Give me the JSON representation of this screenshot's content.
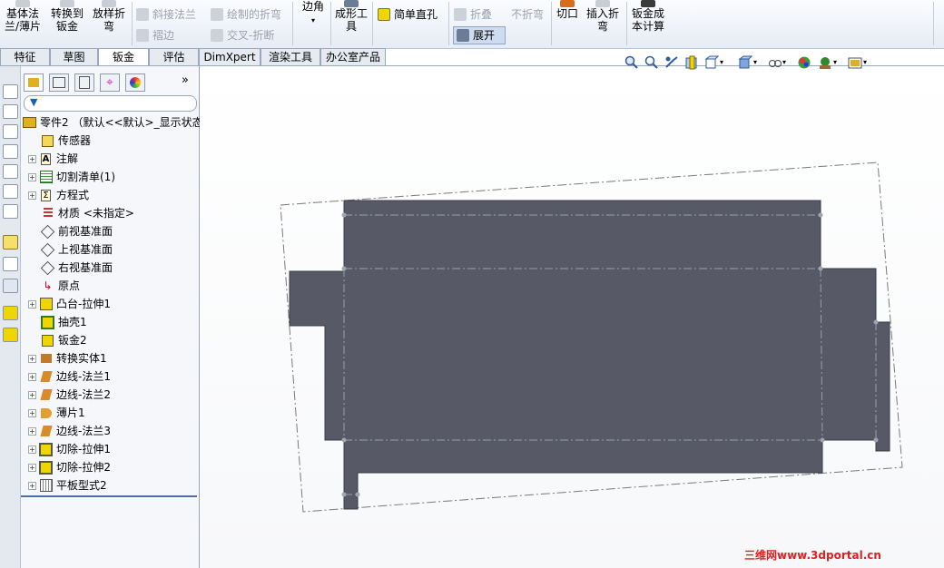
{
  "ribbon": {
    "buttons": [
      {
        "label_line1": "基体法",
        "label_line2": "兰/薄片",
        "enabled": true
      },
      {
        "label_line1": "转换到",
        "label_line2": "钣金",
        "enabled": true
      },
      {
        "label_line1": "放样折",
        "label_line2": "弯",
        "enabled": true
      },
      {
        "label": "斜接法兰",
        "enabled": false
      },
      {
        "label": "褶边",
        "enabled": false
      },
      {
        "label": "绘制的折弯",
        "enabled": false
      },
      {
        "label": "交叉-折断",
        "enabled": false
      },
      {
        "label": "边角",
        "enabled": true
      },
      {
        "label_line1": "成形工",
        "label_line2": "具",
        "enabled": true
      },
      {
        "label": "简单直孔",
        "enabled": true
      },
      {
        "label": "折叠",
        "enabled": false
      },
      {
        "label": "不折弯",
        "enabled": false
      },
      {
        "label": "展开",
        "enabled": true,
        "active": true
      },
      {
        "label": "切口",
        "enabled": true
      },
      {
        "label_line1": "插入折",
        "label_line2": "弯",
        "enabled": true
      },
      {
        "label_line1": "钣金成",
        "label_line2": "本计算",
        "enabled": true
      }
    ]
  },
  "tabs": [
    "特征",
    "草图",
    "钣金",
    "评估",
    "DimXpert",
    "渲染工具",
    "办公室产品"
  ],
  "active_tab": "钣金",
  "panel": {
    "expand_glyph": "»",
    "tree": [
      {
        "label": "零件2 （默认<<默认>_显示状态",
        "expander": false
      },
      {
        "label": "传感器",
        "expander": false
      },
      {
        "label": "注解",
        "expander": true
      },
      {
        "label": "切割清单(1)",
        "expander": true
      },
      {
        "label": "方程式",
        "expander": true
      },
      {
        "label": "材质 <未指定>",
        "expander": false
      },
      {
        "label": "前视基准面",
        "expander": false
      },
      {
        "label": "上视基准面",
        "expander": false
      },
      {
        "label": "右视基准面",
        "expander": false
      },
      {
        "label": "原点",
        "expander": false
      },
      {
        "label": "凸台-拉伸1",
        "expander": true
      },
      {
        "label": "抽壳1",
        "expander": false
      },
      {
        "label": "钣金2",
        "expander": false
      },
      {
        "label": "转换实体1",
        "expander": true
      },
      {
        "label": "边线-法兰1",
        "expander": true
      },
      {
        "label": "边线-法兰2",
        "expander": true
      },
      {
        "label": "薄片1",
        "expander": true
      },
      {
        "label": "边线-法兰3",
        "expander": true
      },
      {
        "label": "切除-拉伸1",
        "expander": true
      },
      {
        "label": "切除-拉伸2",
        "expander": true
      },
      {
        "label": "平板型式2",
        "expander": true
      }
    ]
  },
  "colors": {
    "part_fill": "#575a66",
    "bend_line": "#9a9ea6",
    "bbox_line": "#7a7a7a",
    "active_button_bg": "#cfdcef",
    "watermark": "#e02020"
  },
  "watermark": "三维网www.3dportal.cn"
}
